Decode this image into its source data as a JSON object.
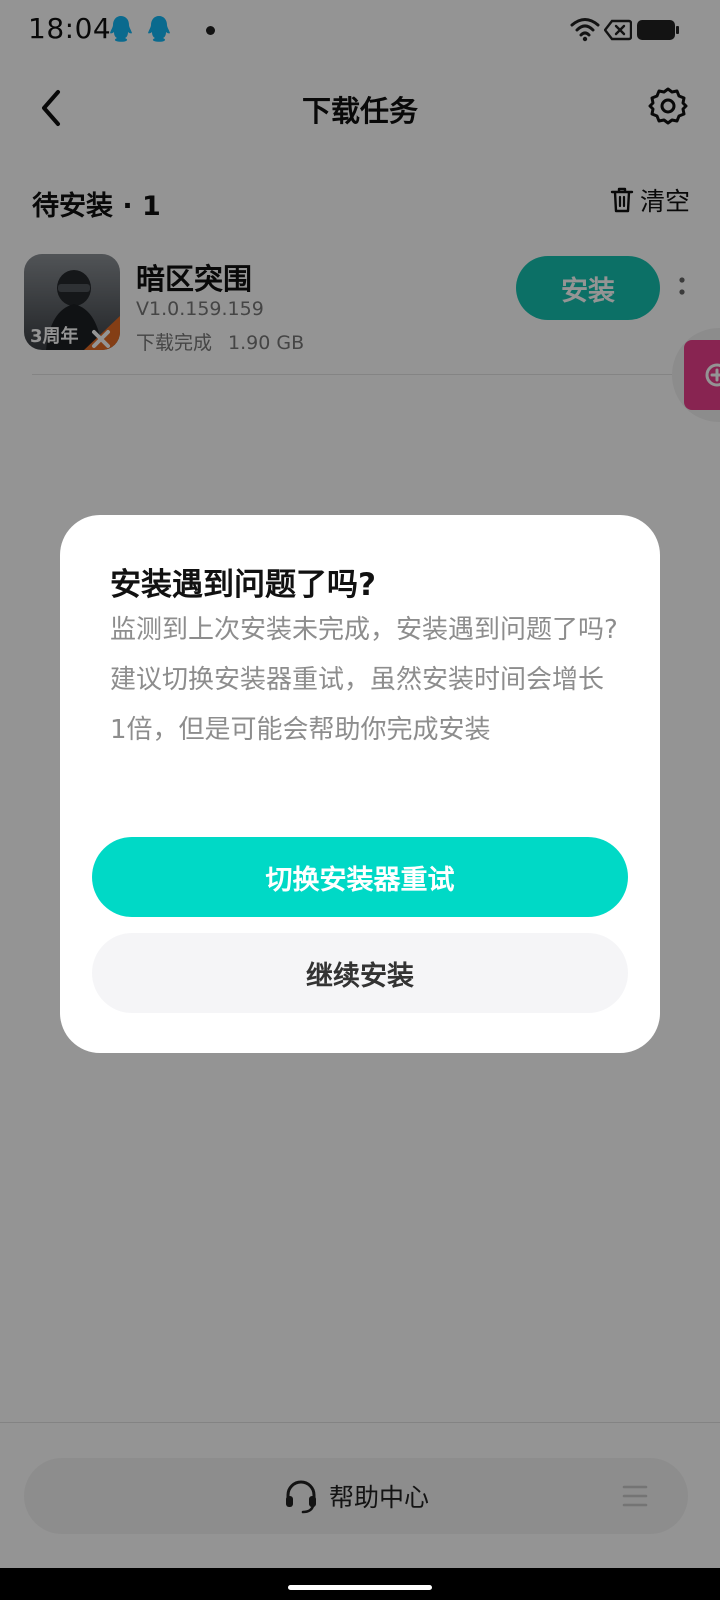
{
  "status_bar": {
    "time": "18:04",
    "icons": [
      "qq-icon",
      "qq-icon",
      "notification-dot",
      "wifi-icon",
      "close-box-icon",
      "battery-icon"
    ]
  },
  "header": {
    "title": "下载任务",
    "back_icon": "back-arrow-icon",
    "settings_icon": "gear-icon"
  },
  "section": {
    "title": "待安装 · 1",
    "clear_label": "清空",
    "clear_icon": "trash-icon"
  },
  "download_item": {
    "name": "暗区突围",
    "version": "V1.0.159.159",
    "status": "下载完成",
    "size": "1.90 GB",
    "icon_badge": "3周年",
    "install_label": "安装"
  },
  "dialog": {
    "title": "安装遇到问题了吗?",
    "body_line1": "监测到上次安装未完成，安装遇到问题了吗?",
    "body_line2": "建议切换安装器重试，虽然安装时间会增长1倍，但是可能会帮助你完成安装",
    "primary_button": "切换安装器重试",
    "secondary_button": "继续安装"
  },
  "footer": {
    "help_label": "帮助中心",
    "help_icon": "headset-icon",
    "menu_icon": "menu-icon"
  },
  "colors": {
    "accent": "#00d9c6",
    "install_button": "#15c2b0",
    "float_widget": "#ea3f8c",
    "scrim": "rgba(0,0,0,0.42)"
  }
}
